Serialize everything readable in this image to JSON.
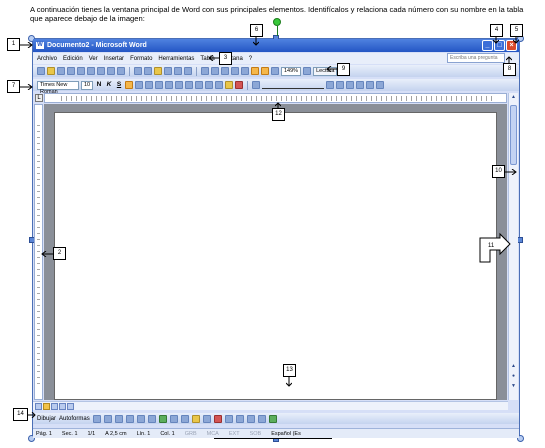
{
  "instructions": "A continuación tienes la ventana principal de Word con sus principales elementos. Identifícalos y relaciona cada número con su nombre en la tabla que aparece debajo de la imagen:",
  "window": {
    "title": "Documento2 - Microsoft Word",
    "app_icon": "W",
    "minimize": "_",
    "maximize": "□",
    "close": "×"
  },
  "menu": {
    "items": [
      "Archivo",
      "Edición",
      "Ver",
      "Insertar",
      "Formato",
      "Herramientas",
      "Tabla",
      "Ventana",
      "?"
    ],
    "help_placeholder": "Escriba una pregunta"
  },
  "standard_toolbar": {
    "zoom": "149%",
    "read_mode": "Lectura"
  },
  "formatting_toolbar": {
    "font": "Times New Roman",
    "size": "10",
    "bold": "N",
    "italic": "K",
    "underline": "S"
  },
  "ruler": {
    "tab_selector": "L"
  },
  "drawing_toolbar": {
    "draw": "Dibujar",
    "autoshapes": "Autoformas"
  },
  "status_bar": {
    "page": "Pág. 1",
    "section": "Sec. 1",
    "pages": "1/1",
    "position": "A 2,5 cm",
    "line": "Lín. 1",
    "column": "Col. 1",
    "modes": [
      "GRB",
      "MCA",
      "EXT",
      "SOB"
    ],
    "language": "Español (Es"
  },
  "callouts": [
    "1",
    "2",
    "3",
    "4",
    "5",
    "6",
    "7",
    "8",
    "9",
    "10",
    "11",
    "12",
    "13",
    "14"
  ]
}
